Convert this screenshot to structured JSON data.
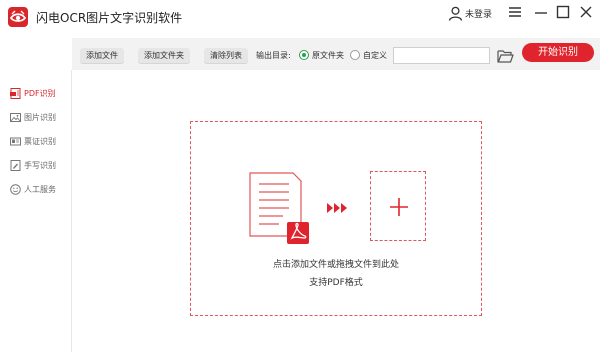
{
  "app": {
    "title": "闪电OCR图片文字识别软件",
    "user_label": "未登录"
  },
  "toolbar": {
    "add_file": "添加文件",
    "add_folder": "添加文件夹",
    "clear_list": "清除列表",
    "output_dir_label": "输出目录:",
    "radio_original": "原文件夹",
    "radio_custom": "自定义",
    "selected_output": "原文件夹",
    "path_value": "",
    "start_button": "开始识别"
  },
  "sidebar": {
    "items": [
      {
        "label": "PDF识别",
        "icon": "pdf-icon",
        "active": true
      },
      {
        "label": "图片识别",
        "icon": "image-icon",
        "active": false
      },
      {
        "label": "票证识别",
        "icon": "id-card-icon",
        "active": false
      },
      {
        "label": "手写识别",
        "icon": "handwriting-icon",
        "active": false
      },
      {
        "label": "人工服务",
        "icon": "smiley-icon",
        "active": false
      }
    ]
  },
  "dropzone": {
    "line1": "点击添加文件或拖拽文件到此处",
    "line2": "支持PDF格式"
  },
  "colors": {
    "accent": "#e0242d",
    "dash": "#e0575b",
    "radio_checked": "#2aa24a",
    "toolbar_bg": "#f2f2f2"
  }
}
